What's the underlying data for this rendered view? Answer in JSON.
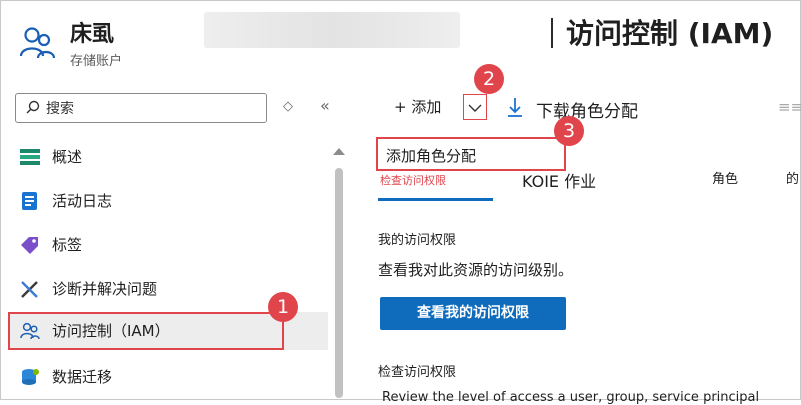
{
  "resource": {
    "name": "床虱",
    "type": "存储账户",
    "icon": "users-icon"
  },
  "page": {
    "title": "访问控制 (IAM)"
  },
  "sidebar": {
    "search_placeholder": "搜索",
    "items": [
      {
        "label": "概述",
        "icon": "overview-icon"
      },
      {
        "label": "活动日志",
        "icon": "activity-log-icon"
      },
      {
        "label": "标签",
        "icon": "tag-icon"
      },
      {
        "label": "诊断并解决问题",
        "icon": "wrench-icon"
      },
      {
        "label": "访问控制（IAM）",
        "icon": "users-icon",
        "active": true
      },
      {
        "label": "数据迁移",
        "icon": "data-migration-icon"
      }
    ]
  },
  "toolbar": {
    "add_label": "+ 添加",
    "download_label": "下载角色分配",
    "more": "≡≡"
  },
  "dropdown": {
    "items": [
      "添加角色分配"
    ]
  },
  "tabs": {
    "check_access": "检查访问权限",
    "koie": "KOIE 作业",
    "roles": "角色",
    "cut": "的"
  },
  "my_access": {
    "heading": "我的访问权限",
    "description": "查看我对此资源的访问级别。",
    "button": "查看我的访问权限"
  },
  "check_access": {
    "heading": "检查访问权限",
    "description": "Review the level of access a user, group, service principal"
  },
  "callouts": [
    "1",
    "2",
    "3"
  ],
  "colors": {
    "accent": "#0f6cbd",
    "callout": "#e0454c"
  }
}
